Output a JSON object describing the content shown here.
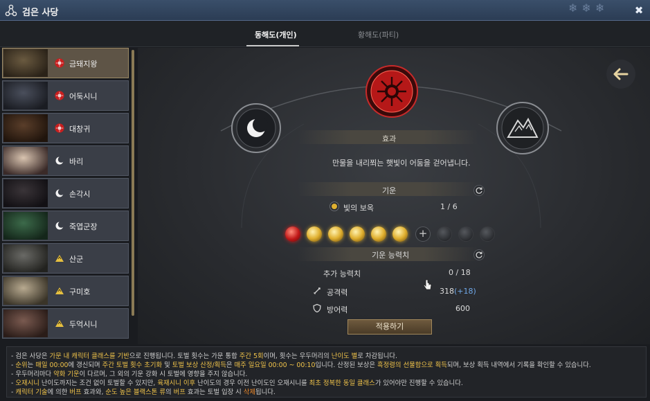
{
  "window": {
    "title": "검은 사당"
  },
  "tabs": [
    {
      "label": "동해도(개인)",
      "active": true
    },
    {
      "label": "황해도(파티)",
      "active": false
    }
  ],
  "bosses": [
    {
      "name": "금돼지왕",
      "type": "sun",
      "selected": true
    },
    {
      "name": "어둑시니",
      "type": "sun",
      "selected": false
    },
    {
      "name": "대창귀",
      "type": "sun",
      "selected": false
    },
    {
      "name": "바리",
      "type": "moon",
      "selected": false
    },
    {
      "name": "손각시",
      "type": "moon",
      "selected": false
    },
    {
      "name": "죽엽군장",
      "type": "moon",
      "selected": false
    },
    {
      "name": "산군",
      "type": "mountain",
      "selected": false
    },
    {
      "name": "구미호",
      "type": "mountain",
      "selected": false
    },
    {
      "name": "두억시니",
      "type": "mountain",
      "selected": false
    }
  ],
  "effect": {
    "title": "효과",
    "description": "만물을 내리쬐는 햇빛이 어둠을 걷어냅니다."
  },
  "qi": {
    "title": "기운",
    "item_name": "빛의 보옥",
    "item_count": "1 / 6",
    "orbs": [
      "red",
      "gold",
      "gold",
      "gold",
      "gold",
      "gold",
      "plus",
      "dark",
      "dark",
      "dark"
    ]
  },
  "stats": {
    "title": "기운 능력치",
    "extra_label": "추가 능력치",
    "extra_value": "0 / 18",
    "attack_label": "공격력",
    "attack_value": "318",
    "attack_bonus": "(+18)",
    "defense_label": "방어력",
    "defense_value": "600"
  },
  "apply_button": "적용하기",
  "footer": {
    "line1": [
      [
        "- 검은 사당은 ",
        ""
      ],
      [
        "가문 내 캐릭터 클래스를 기반",
        "y"
      ],
      [
        "으로 진행됩니다. 토벌 횟수는 가문 통합 ",
        ""
      ],
      [
        "주간 5회",
        "y"
      ],
      [
        "이며, 횟수는 우두머리의 ",
        ""
      ],
      [
        "난이도 별",
        "y"
      ],
      [
        "로 차감됩니다.",
        ""
      ]
    ],
    "line2": [
      [
        "- ",
        ""
      ],
      [
        "순위",
        "y"
      ],
      [
        "는 ",
        ""
      ],
      [
        "매일 00:00",
        "y"
      ],
      [
        "에 갱신되며 ",
        ""
      ],
      [
        "주간 토벌 횟수 초기화",
        "y"
      ],
      [
        " 및 ",
        ""
      ],
      [
        "토벌 보상 산정/획득",
        "y"
      ],
      [
        "은 ",
        ""
      ],
      [
        "매주 일요일 00:00 ~ 00:10",
        "y"
      ],
      [
        "입니다. 산정된 보상은 ",
        ""
      ],
      [
        "흑정령의 선물함으로 획득",
        "y"
      ],
      [
        "되며, 보상 획득 내역에서 기록을 확인할 수 있습니다.",
        ""
      ]
    ],
    "line3": [
      [
        "- 우두머리마다 ",
        ""
      ],
      [
        "약화 기운",
        "y"
      ],
      [
        "이 다르며, 그 외의 기운 강화 시 토벌에 영향을 주지 않습니다.",
        ""
      ]
    ],
    "line4": [
      [
        "- ",
        ""
      ],
      [
        "오재시니",
        "y"
      ],
      [
        " 난이도까지는 조건 없이 토벌할 수 있지만, ",
        ""
      ],
      [
        "육재시니 이후",
        "y"
      ],
      [
        " 난이도의 경우 이전 난이도인 오재시니를 ",
        ""
      ],
      [
        "최초 정복한 동일 클래스",
        "y"
      ],
      [
        "가 있어야만 진행할 수 있습니다.",
        ""
      ]
    ],
    "line5": [
      [
        "- ",
        ""
      ],
      [
        "캐릭터 기술",
        "y"
      ],
      [
        "에 의한 ",
        ""
      ],
      [
        "버프",
        "y"
      ],
      [
        " 효과와, ",
        ""
      ],
      [
        "순도 높은 블랙스톤 류",
        "y"
      ],
      [
        "의 ",
        ""
      ],
      [
        "버프",
        "y"
      ],
      [
        " 효과는 토벌 입장 시 ",
        ""
      ],
      [
        "삭제",
        "o"
      ],
      [
        "됩니다.",
        ""
      ]
    ]
  },
  "colors": {
    "accent_gold": "#f0c34a",
    "accent_blue": "#6fa8e8",
    "sun_red": "#d02020"
  },
  "icons": {
    "sun": "sun-icon",
    "moon": "moon-icon",
    "mountain": "mountain-icon"
  }
}
